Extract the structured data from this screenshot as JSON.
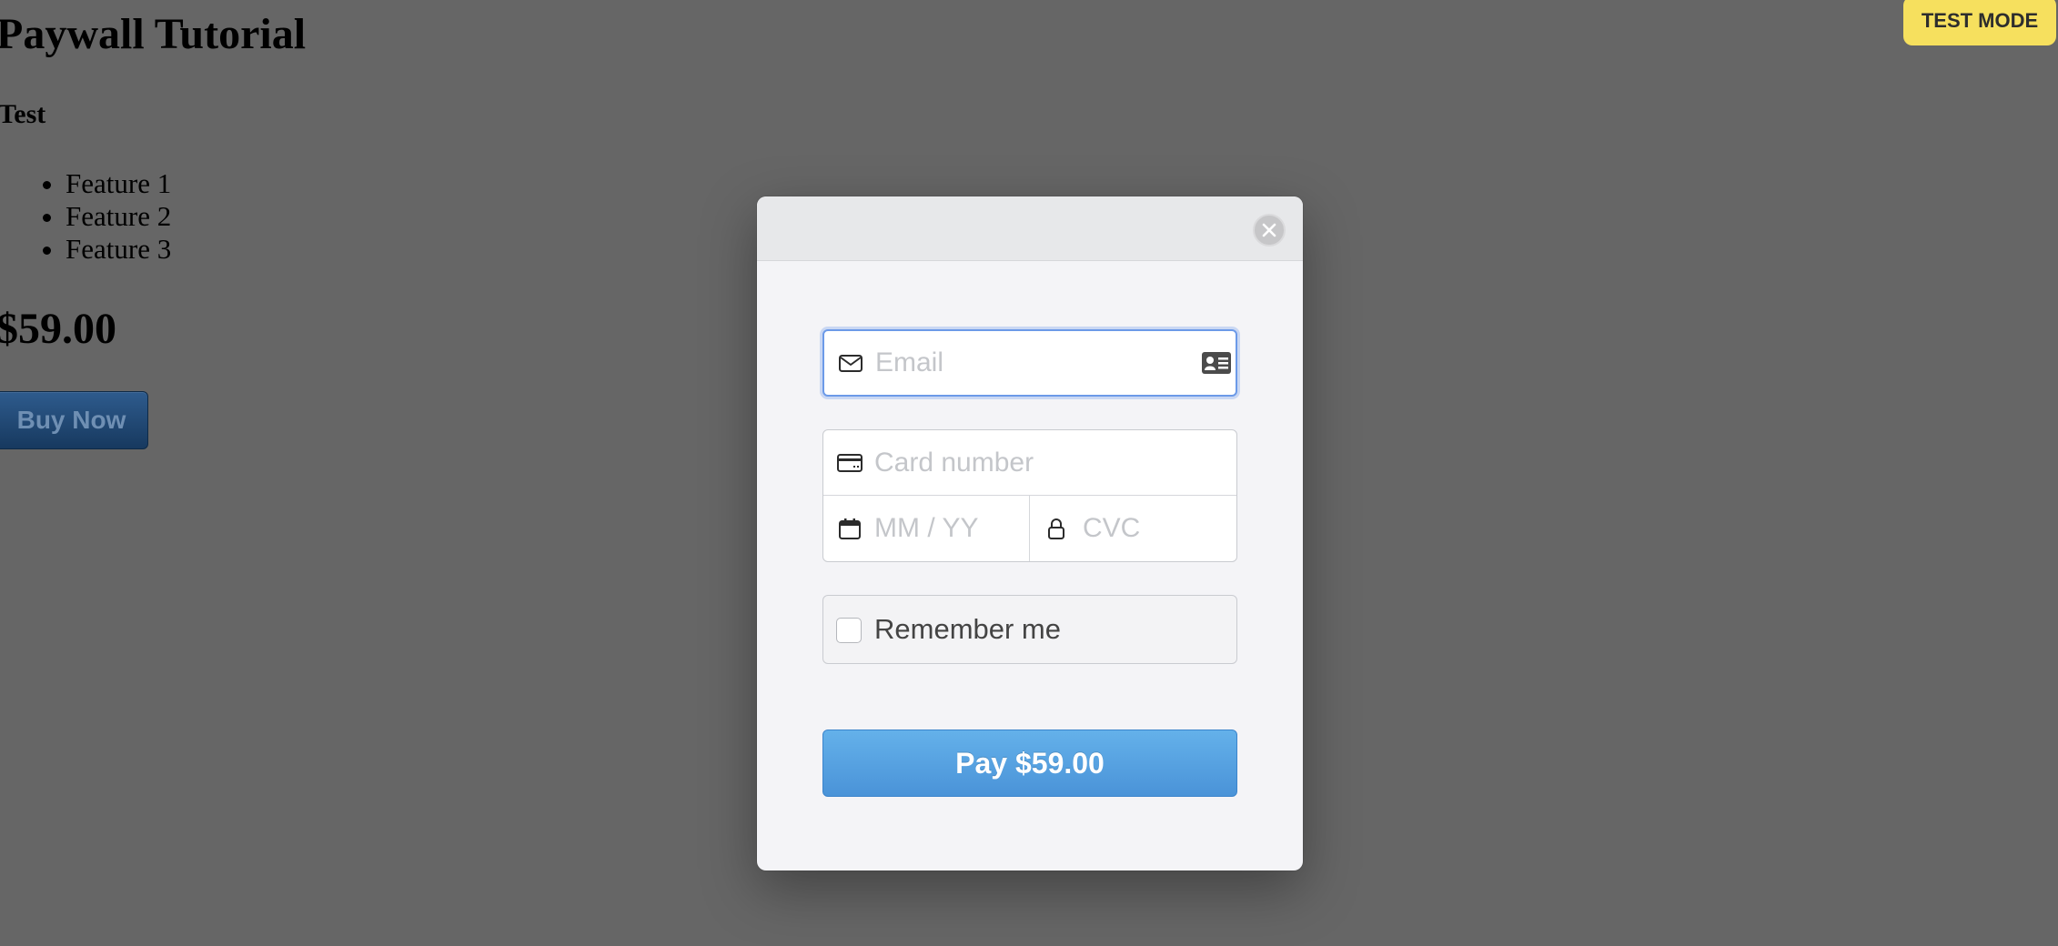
{
  "page": {
    "title": "Paywall Tutorial",
    "subtitle": "Test",
    "features": [
      "Feature 1",
      "Feature 2",
      "Feature 3"
    ],
    "price": "$59.00",
    "buy_label": "Buy Now"
  },
  "badge": {
    "label": "TEST MODE"
  },
  "modal": {
    "email_placeholder": "Email",
    "card_number_placeholder": "Card number",
    "expiry_placeholder": "MM / YY",
    "cvc_placeholder": "CVC",
    "remember_label": "Remember me",
    "pay_label": "Pay $59.00"
  },
  "icons": {
    "close": "close-icon",
    "email": "envelope-icon",
    "contact_card": "contact-card-icon",
    "card": "credit-card-icon",
    "expiry": "calendar-icon",
    "cvc": "lock-icon"
  },
  "colors": {
    "overlay": "#666666",
    "badge": "#f6e05e",
    "pay_button": "#4a93d8",
    "focus_ring": "#6c9ae8"
  }
}
